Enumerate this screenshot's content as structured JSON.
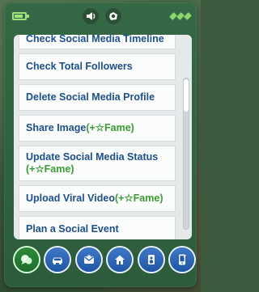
{
  "menu": {
    "items": [
      {
        "text": "Check Social Media Timeline",
        "fame": ""
      },
      {
        "text": "Check Total Followers",
        "fame": ""
      },
      {
        "text": "Delete Social Media Profile",
        "fame": ""
      },
      {
        "text": "Share Image ",
        "fame": "(+☆Fame)"
      },
      {
        "text": "Update Social Media Status ",
        "fame": "(+☆Fame)"
      },
      {
        "text": "Upload Viral Video ",
        "fame": "(+☆Fame)"
      },
      {
        "text": "Plan a Social Event",
        "fame": ""
      }
    ]
  },
  "icons": {
    "top_left": "battery-icon",
    "top_center": [
      "speaker-icon",
      "camera-icon"
    ],
    "top_right": "signal-icon",
    "bottom": [
      "chat-icon",
      "car-icon",
      "mail-icon",
      "home-icon",
      "audio-icon",
      "phone-app-icon"
    ]
  },
  "colors": {
    "panel": "#2d5c3c",
    "menu_bg": "#e6e9ea",
    "item_text": "#1d4f8a",
    "fame_text": "#3a9a33",
    "battery": "#9fe37e",
    "app_icon_blue": "#1f56a6",
    "app_icon_active_green": "#1f6e2c"
  }
}
